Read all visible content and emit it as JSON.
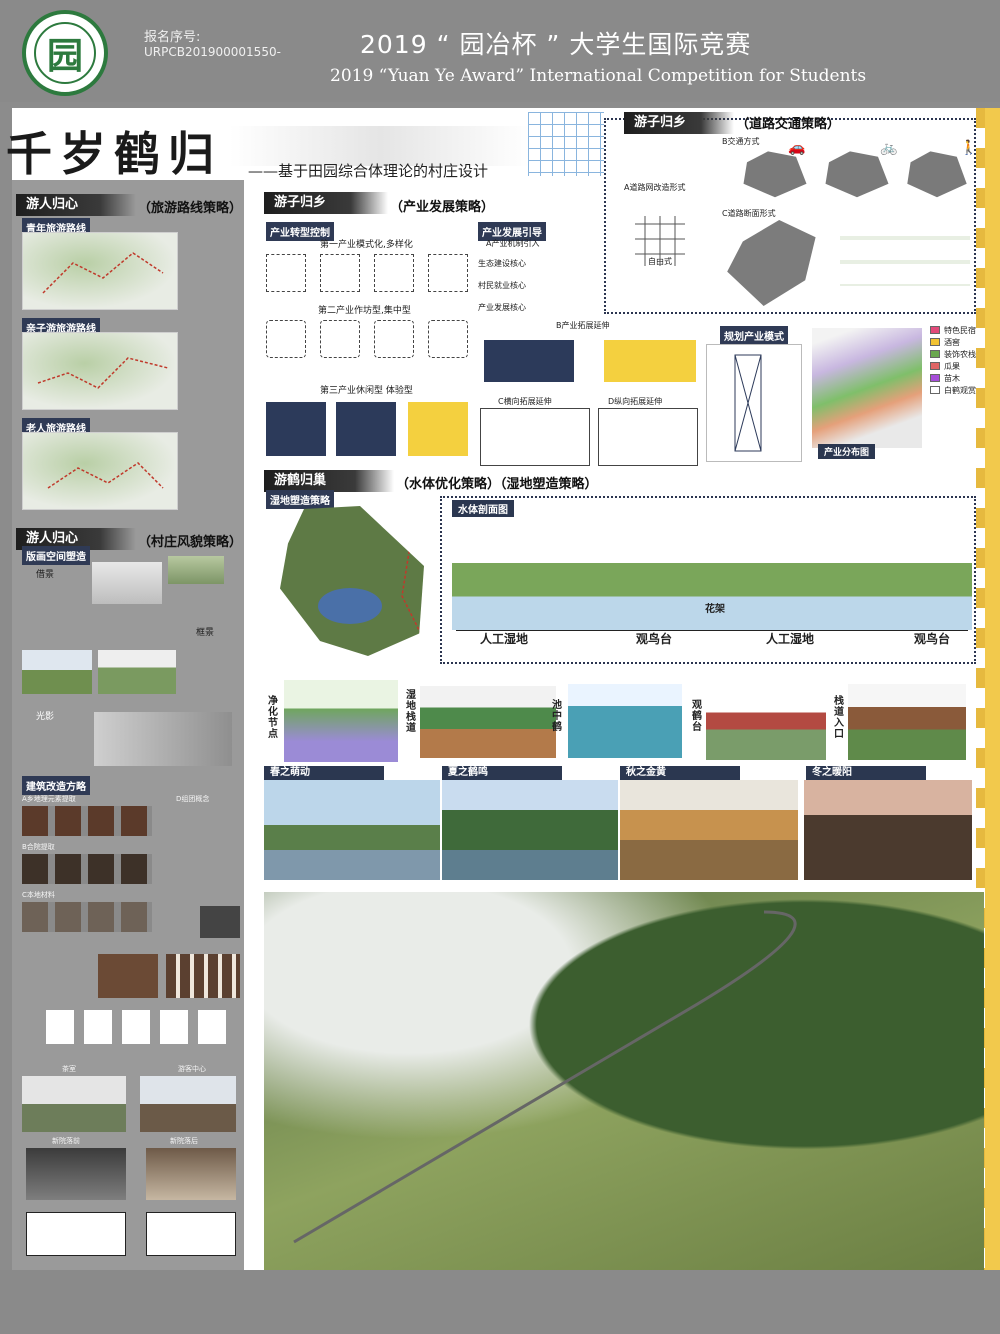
{
  "header": {
    "reg_label": "报名序号:",
    "reg_id": "URPCB201900001550-",
    "title_cn": "2019 “ 园冶杯 ” 大学生国际竞赛",
    "title_en": "2019 “Yuan Ye Award” International Competition for  Students",
    "logo_char": "园"
  },
  "title": {
    "main": "千岁鹤归",
    "sub": "——基于田园综合体理论的村庄设计"
  },
  "sections": {
    "tour_routes": {
      "head": "游人归心",
      "sub": "（旅游路线策略）"
    },
    "village_style": {
      "head": "游人归心",
      "sub": "（村庄风貌策略）"
    },
    "industry": {
      "head": "游子归乡",
      "sub": "（产业发展策略）"
    },
    "transport": {
      "head": "游子归乡",
      "sub": "（道路交通策略）"
    },
    "water": {
      "head": "游鹤归巢",
      "sub": "（水体优化策略）（湿地塑造策略）"
    }
  },
  "routes": [
    {
      "label": "青年旅游路线"
    },
    {
      "label": "亲子游旅游路线"
    },
    {
      "label": "老人旅游路线"
    }
  ],
  "village": {
    "facade_tag": "版画空间塑造",
    "light_label": "借景",
    "view_label": "框景",
    "shadow_label": "光影",
    "renovate_tag": "建筑改造方略",
    "renovate_a": "A乡地理元素提取",
    "renovate_b": "B合院提取",
    "renovate_c": "C本地材料",
    "renovate_d": "D组团概念",
    "tea_label": "茶室",
    "visitor_label": "游客中心",
    "new_a": "新院落前",
    "new_b": "新院落后"
  },
  "industry": {
    "transform_tag": "产业转型控制",
    "guide_tag": "产业发展引导",
    "primary": "第一产业模式化,多样化",
    "secondary": "第二产业作坊型,集中型",
    "tertiary": "第三产业休闲型 体验型",
    "mechanism": "A产业机制引入",
    "eco_core": "生态建设核心",
    "village_core": "村民就业核心",
    "industry_core": "产业发展核心",
    "expand": "B产业拓展延伸",
    "h_extend": "C横向拓展延伸",
    "v_extend": "D纵向拓展延伸",
    "plan_tag": "规划产业模式",
    "dist_tag": "产业分布图",
    "legend": [
      {
        "name": "特色民宿",
        "color": "#e24a7a"
      },
      {
        "name": "酒窖",
        "color": "#f1c232"
      },
      {
        "name": "装饰农栈",
        "color": "#6aa84f"
      },
      {
        "name": "瓜果",
        "color": "#e06666"
      },
      {
        "name": "苗木",
        "color": "#a64dd9"
      },
      {
        "name": "白鹤观赏",
        "color": "#ffffff"
      }
    ]
  },
  "transport": {
    "a_label": "A道路网改造形式",
    "b_label": "B交通方式",
    "c_label": "C道路断面形式",
    "alley": "自由式"
  },
  "water": {
    "wetland_tag": "湿地塑造策略",
    "profile_tag": "水体剖面图",
    "profile_labels": [
      "人工湿地",
      "观鸟台",
      "人工湿地",
      "观鸟台"
    ],
    "flower": "花架",
    "nodes": [
      "净化节点",
      "湿地栈道",
      "池中鹤",
      "观鹤台",
      "栈道入口"
    ],
    "seasons": [
      "春之萌动",
      "夏之鹤鸣",
      "秋之金黄",
      "冬之暖阳"
    ]
  },
  "colors": {
    "navy": "#2c3a5a",
    "accent_yellow": "#f2c94c",
    "board_gray": "#8a8a8a"
  }
}
